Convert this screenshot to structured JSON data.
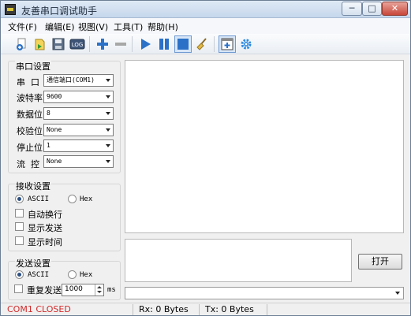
{
  "window": {
    "title": "友善串口调试助手",
    "min_glyph": "─",
    "max_glyph": "□",
    "close_glyph": "✕"
  },
  "menu": [
    "文件(F)",
    "编辑(E)",
    "视图(V)",
    "工具(T)",
    "帮助(H)"
  ],
  "toolbar": {
    "log_label": "LOG",
    "icons": [
      "new-session-icon",
      "open-file-icon",
      "save-icon",
      "log-icon",
      "add-icon",
      "remove-icon",
      "play-icon",
      "pause-icon",
      "stop-icon",
      "clear-broom-icon",
      "add-panel-icon",
      "settings-gear-icon"
    ]
  },
  "serial_settings": {
    "title": "串口设置",
    "port_label": "串  口",
    "port_value": "通信端口(COM1)",
    "baud_label": "波特率",
    "baud_value": "9600",
    "databits_label": "数据位",
    "databits_value": "8",
    "parity_label": "校验位",
    "parity_value": "None",
    "stopbits_label": "停止位",
    "stopbits_value": "1",
    "flow_label": "流  控",
    "flow_value": "None"
  },
  "receive_settings": {
    "title": "接收设置",
    "ascii_label": "ASCII",
    "hex_label": "Hex",
    "selected": "ASCII",
    "autowrap_label": "自动换行",
    "show_send_label": "显示发送",
    "show_time_label": "显示时间"
  },
  "send_settings": {
    "title": "发送设置",
    "ascii_label": "ASCII",
    "hex_label": "Hex",
    "selected": "ASCII",
    "repeat_label": "重复发送",
    "interval_value": "1000",
    "interval_unit": "ms"
  },
  "actions": {
    "open_label": "打开"
  },
  "status": {
    "port_status": "COM1 CLOSED",
    "rx": "Rx: 0 Bytes",
    "tx": "Tx: 0 Bytes"
  },
  "colors": {
    "port_status": "#d22a2a",
    "toolbar_blue": "#2b71c8"
  }
}
